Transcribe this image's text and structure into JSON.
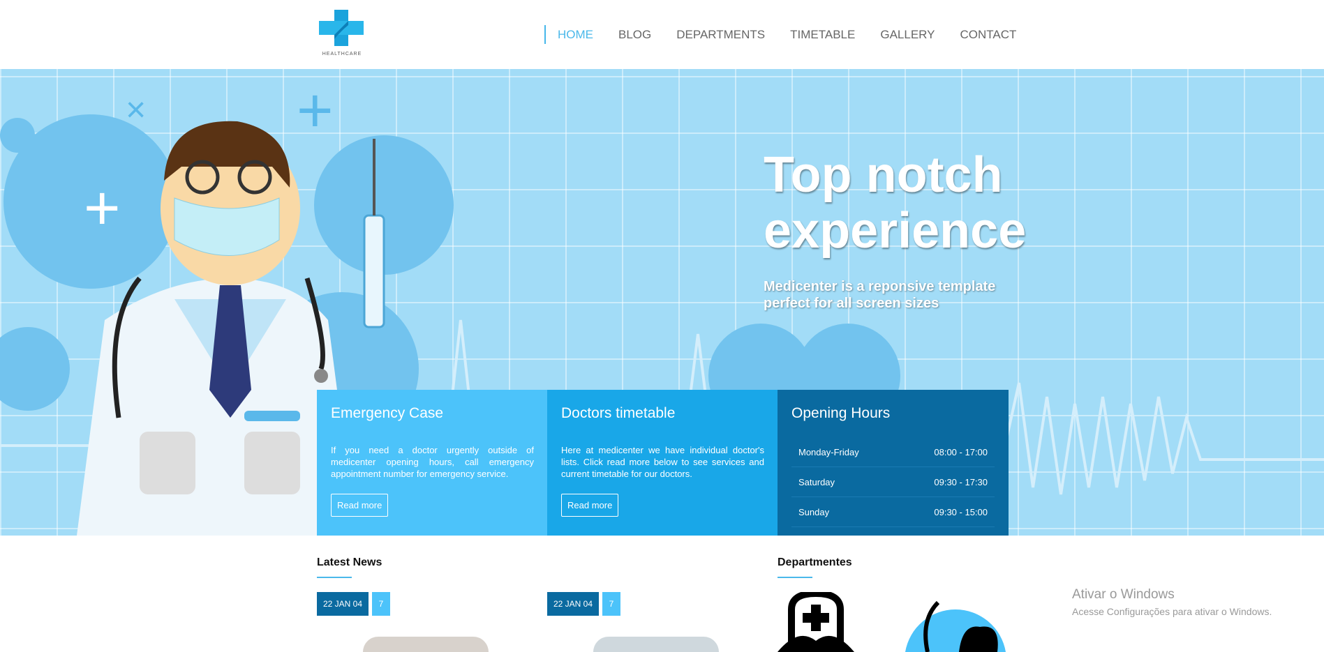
{
  "header": {
    "logo_text": "HEALTHCARE",
    "nav": [
      {
        "label": "HOME",
        "active": true
      },
      {
        "label": "BLOG"
      },
      {
        "label": "DEPARTMENTS"
      },
      {
        "label": "TIMETABLE"
      },
      {
        "label": "GALLERY"
      },
      {
        "label": "CONTACT"
      }
    ]
  },
  "hero": {
    "title_line1": "Top notch",
    "title_line2": "experience",
    "subtitle_line1": "Medicenter is a reponsive template",
    "subtitle_line2": "perfect for all screen sizes"
  },
  "boxes": {
    "emergency": {
      "title": "Emergency Case",
      "text": "If you need a doctor urgently outside of medicenter opening hours, call emergency appointment number for emergency service.",
      "button": "Read more"
    },
    "timetable": {
      "title": "Doctors timetable",
      "text": "Here at medicenter we have individual doctor's lists. Click read more below to see services and current timetable for our doctors.",
      "button": "Read more"
    },
    "hours": {
      "title": "Opening Hours",
      "rows": [
        {
          "day": "Monday-Friday",
          "time": "08:00 - 17:00"
        },
        {
          "day": "Saturday",
          "time": "09:30 - 17:30"
        },
        {
          "day": "Sunday",
          "time": "09:30 - 15:00"
        }
      ]
    }
  },
  "news": {
    "title": "Latest News",
    "items": [
      {
        "date": "22 JAN 04",
        "count": "7"
      },
      {
        "date": "22 JAN 04",
        "count": "7"
      }
    ]
  },
  "departments": {
    "title": "Departmentes"
  },
  "watermark": {
    "line1": "Ativar o Windows",
    "line2": "Acesse Configurações para ativar o Windows."
  },
  "colors": {
    "accent": "#4ab8ea",
    "box1": "#4cc3fa",
    "box2": "#19a7e8",
    "box3": "#0a6aa0"
  }
}
